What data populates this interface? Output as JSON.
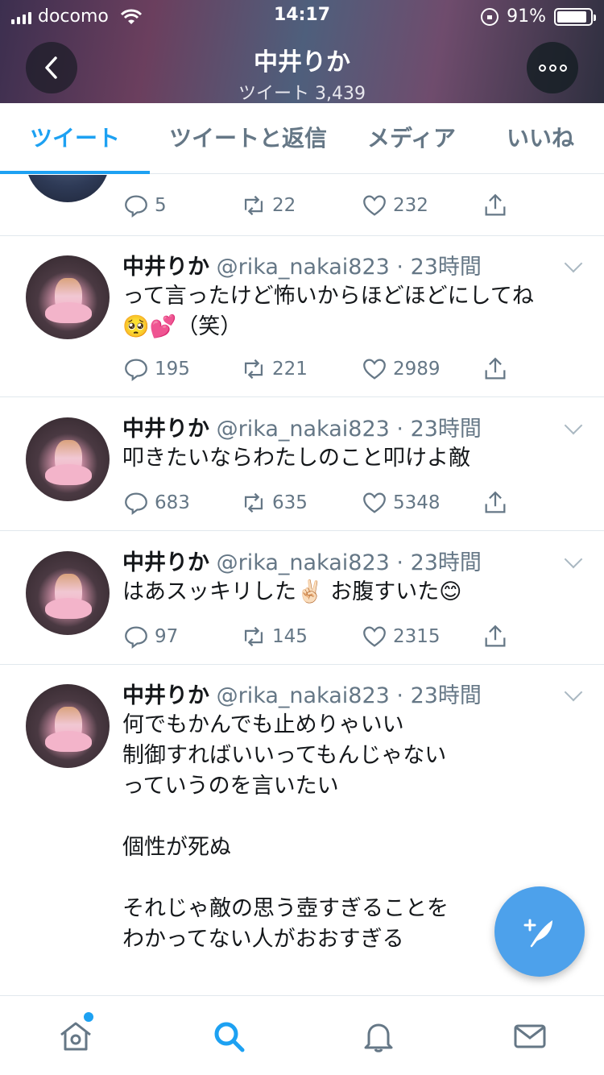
{
  "status_bar": {
    "carrier": "docomo",
    "time": "14:17",
    "battery": "91%",
    "battery_level": 0.91
  },
  "profile": {
    "name": "中井りか",
    "tweet_count": "ツイート 3,439"
  },
  "tabs": [
    {
      "label": "ツイート",
      "active": true
    },
    {
      "label": "ツイートと返信",
      "active": false
    },
    {
      "label": "メディア",
      "active": false
    },
    {
      "label": "いいね",
      "active": false
    }
  ],
  "tweets": [
    {
      "partial": true,
      "replies": "5",
      "retweets": "22",
      "likes": "232"
    },
    {
      "name": "中井りか",
      "handle": "@rika_nakai823",
      "time": "· 23時間",
      "text": "って言ったけど怖いからほどほどにしてね\n🥺💕（笑）",
      "replies": "195",
      "retweets": "221",
      "likes": "2989"
    },
    {
      "name": "中井りか",
      "handle": "@rika_nakai823",
      "time": "· 23時間",
      "text": "叩きたいならわたしのこと叩けよ敵",
      "replies": "683",
      "retweets": "635",
      "likes": "5348"
    },
    {
      "name": "中井りか",
      "handle": "@rika_nakai823",
      "time": "· 23時間",
      "text": "はあスッキリした✌🏻 お腹すいた😊",
      "replies": "97",
      "retweets": "145",
      "likes": "2315"
    },
    {
      "name": "中井りか",
      "handle": "@rika_nakai823",
      "time": "· 23時間",
      "text": "何でもかんでも止めりゃいい\n制御すればいいってもんじゃない\nっていうのを言いたい\n\n個性が死ぬ\n\nそれじゃ敵の思う壺すぎることを\nわかってない人がおおすぎる"
    }
  ],
  "colors": {
    "accent": "#1da1f2",
    "muted": "#657786",
    "fab": "#4da1eb"
  },
  "bottom_nav": [
    "home-icon",
    "search-icon",
    "notifications-icon",
    "messages-icon"
  ]
}
